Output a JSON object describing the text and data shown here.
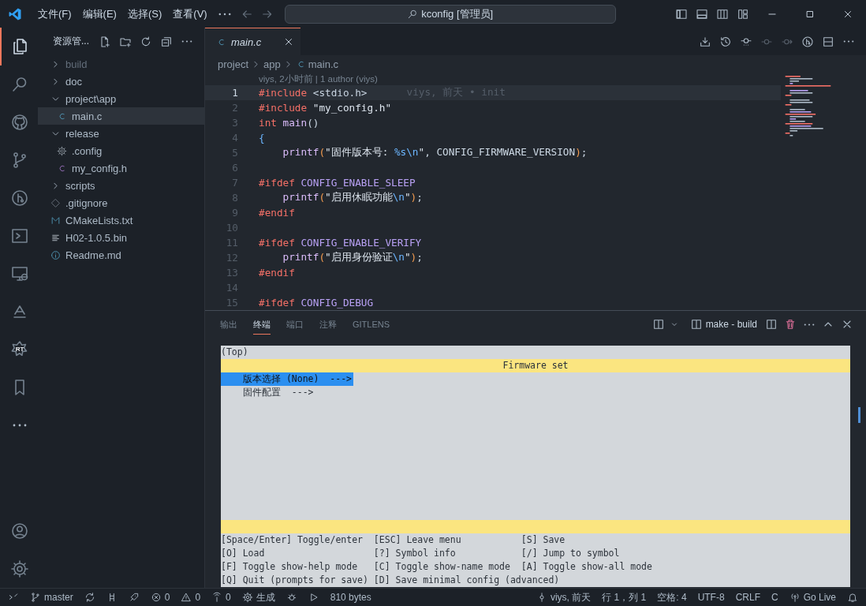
{
  "title_bar": {
    "menus": [
      "文件(F)",
      "编辑(E)",
      "选择(S)",
      "查看(V)"
    ],
    "search": "kconfig [管理员]"
  },
  "activity_bar": {
    "items": [
      {
        "kind": "explorer",
        "selected": true
      },
      {
        "kind": "search",
        "selected": false
      },
      {
        "kind": "github",
        "selected": false
      },
      {
        "kind": "scm",
        "selected": false
      },
      {
        "kind": "gitlens",
        "selected": false
      },
      {
        "kind": "terminal",
        "selected": false
      },
      {
        "kind": "remote",
        "selected": false
      },
      {
        "kind": "deploy",
        "selected": false
      },
      {
        "kind": "rt",
        "label": "RT",
        "selected": false
      },
      {
        "kind": "bookmark",
        "selected": false
      },
      {
        "kind": "more",
        "selected": false
      }
    ],
    "bottom": [
      {
        "kind": "account"
      },
      {
        "kind": "settings"
      }
    ]
  },
  "sidebar": {
    "title": "资源管...",
    "tree": [
      {
        "name": "build",
        "kind": "folder",
        "expanded": false,
        "selected": false,
        "dimmed": true
      },
      {
        "name": "doc",
        "kind": "folder",
        "expanded": false,
        "selected": false,
        "dimmed": false
      },
      {
        "name": "project\\app",
        "kind": "folder",
        "expanded": true,
        "selected": false,
        "dimmed": false,
        "children": [
          {
            "name": "main.c",
            "kind": "c",
            "selected": true,
            "dimmed": false
          }
        ]
      },
      {
        "name": "release",
        "kind": "folder",
        "expanded": true,
        "selected": false,
        "dimmed": false,
        "children": [
          {
            "name": ".config",
            "kind": "gear",
            "selected": false,
            "dimmed": false
          },
          {
            "name": "my_config.h",
            "kind": "h",
            "selected": false,
            "dimmed": false
          }
        ]
      },
      {
        "name": "scripts",
        "kind": "folder",
        "expanded": false,
        "selected": false,
        "dimmed": false
      },
      {
        "name": ".gitignore",
        "kind": "git",
        "selected": false,
        "dimmed": false
      },
      {
        "name": "CMakeLists.txt",
        "kind": "cmake",
        "selected": false,
        "dimmed": false
      },
      {
        "name": "H02-1.0.5.bin",
        "kind": "lines",
        "selected": false,
        "dimmed": false
      },
      {
        "name": "Readme.md",
        "kind": "info",
        "selected": false,
        "dimmed": false
      }
    ]
  },
  "editor": {
    "tabs": [
      {
        "label": "main.c",
        "selected": true
      }
    ],
    "breadcrumb": [
      "project",
      "app",
      "main.c"
    ],
    "codelens": "viys, 2小时前 | 1 author (viys)",
    "lines": [
      {
        "number": "1",
        "current": true,
        "blame": "viys, 前天 • init",
        "tokens": [
          {
            "kind": "pp",
            "text": "#include "
          },
          {
            "kind": "hdr",
            "text": "<stdio.h>"
          }
        ]
      },
      {
        "number": "2",
        "current": false,
        "tokens": [
          {
            "kind": "pp",
            "text": "#include "
          },
          {
            "kind": "str",
            "text": "\"my_config.h\""
          }
        ]
      },
      {
        "number": "3",
        "current": false,
        "tokens": [
          {
            "kind": "pp",
            "text": "int "
          },
          {
            "kind": "fn",
            "text": "main"
          },
          {
            "kind": "plain",
            "text": "()"
          }
        ]
      },
      {
        "number": "4",
        "current": false,
        "tokens": [
          {
            "kind": "esc",
            "text": "{"
          }
        ]
      },
      {
        "number": "5",
        "current": false,
        "tokens": [
          {
            "kind": "fn",
            "text": "    printf"
          },
          {
            "kind": "paren",
            "text": "("
          },
          {
            "kind": "str",
            "text": "\"固件版本号: "
          },
          {
            "kind": "esc",
            "text": "%s\\n"
          },
          {
            "kind": "str",
            "text": "\""
          },
          {
            "kind": "plain",
            "text": ", CONFIG_FIRMWARE_VERSION"
          },
          {
            "kind": "paren",
            "text": ")"
          },
          {
            "kind": "plain",
            "text": ";"
          }
        ]
      },
      {
        "number": "6",
        "current": false
      },
      {
        "number": "7",
        "current": false,
        "tokens": [
          {
            "kind": "pp",
            "text": "#ifdef "
          },
          {
            "kind": "macro",
            "text": "CONFIG_ENABLE_SLEEP"
          }
        ]
      },
      {
        "number": "8",
        "current": false,
        "tokens": [
          {
            "kind": "fn",
            "text": "    printf"
          },
          {
            "kind": "paren",
            "text": "("
          },
          {
            "kind": "str",
            "text": "\"启用休眠功能"
          },
          {
            "kind": "esc",
            "text": "\\n"
          },
          {
            "kind": "str",
            "text": "\""
          },
          {
            "kind": "paren",
            "text": ")"
          },
          {
            "kind": "plain",
            "text": ";"
          }
        ]
      },
      {
        "number": "9",
        "current": false,
        "tokens": [
          {
            "kind": "pp",
            "text": "#endif"
          }
        ]
      },
      {
        "number": "10",
        "current": false
      },
      {
        "number": "11",
        "current": false,
        "tokens": [
          {
            "kind": "pp",
            "text": "#ifdef "
          },
          {
            "kind": "macro",
            "text": "CONFIG_ENABLE_VERIFY"
          }
        ]
      },
      {
        "number": "12",
        "current": false,
        "tokens": [
          {
            "kind": "fn",
            "text": "    printf"
          },
          {
            "kind": "paren",
            "text": "("
          },
          {
            "kind": "str",
            "text": "\"启用身份验证"
          },
          {
            "kind": "esc",
            "text": "\\n"
          },
          {
            "kind": "str",
            "text": "\""
          },
          {
            "kind": "paren",
            "text": ")"
          },
          {
            "kind": "plain",
            "text": ";"
          }
        ]
      },
      {
        "number": "13",
        "current": false,
        "tokens": [
          {
            "kind": "pp",
            "text": "#endif"
          }
        ]
      },
      {
        "number": "14",
        "current": false
      },
      {
        "number": "15",
        "current": false,
        "tokens": [
          {
            "kind": "pp",
            "text": "#ifdef "
          },
          {
            "kind": "macro",
            "text": "CONFIG_DEBUG"
          }
        ]
      }
    ]
  },
  "panel": {
    "tabs": [
      {
        "label": "输出",
        "selected": false
      },
      {
        "label": "终端",
        "selected": true
      },
      {
        "label": "端口",
        "selected": false
      },
      {
        "label": "注释",
        "selected": false
      },
      {
        "label": "GITLENS",
        "selected": false
      }
    ],
    "terminal_name": "make - build",
    "terminal": {
      "header": "(Top)",
      "title": "Firmware set",
      "items": [
        {
          "text": "版本选择 (None)  --->",
          "selected": true
        },
        {
          "text": "固件配置  --->",
          "selected": false
        }
      ],
      "help": [
        "[Space/Enter] Toggle/enter  [ESC] Leave menu           [S] Save",
        "[O] Load                    [?] Symbol info            [/] Jump to symbol",
        "[F] Toggle show-help mode   [C] Toggle show-name mode  [A] Toggle show-all mode",
        "[Q] Quit (prompts for save) [D] Save minimal config (advanced)"
      ]
    }
  },
  "status_bar": {
    "left": [
      {
        "kind": "remote"
      },
      {
        "kind": "branch",
        "text": "master"
      },
      {
        "kind": "sync"
      },
      {
        "kind": "graph"
      },
      {
        "kind": "rocket"
      },
      {
        "kind": "error",
        "text": "0"
      },
      {
        "kind": "warning",
        "text": "0"
      },
      {
        "kind": "ports",
        "text": "0"
      },
      {
        "kind": "gear",
        "text": "生成"
      },
      {
        "kind": "bug"
      },
      {
        "kind": "play"
      },
      {
        "kind": "none",
        "text": "810 bytes"
      }
    ],
    "right": [
      {
        "kind": "commit",
        "text": "viys, 前天"
      },
      {
        "kind": "none",
        "text": "行 1，列 1"
      },
      {
        "kind": "none",
        "text": "空格: 4"
      },
      {
        "kind": "none",
        "text": "UTF-8"
      },
      {
        "kind": "none",
        "text": "CRLF"
      },
      {
        "kind": "none",
        "text": "C"
      },
      {
        "kind": "broadcast",
        "text": "Go Live"
      },
      {
        "kind": "bell"
      }
    ]
  }
}
